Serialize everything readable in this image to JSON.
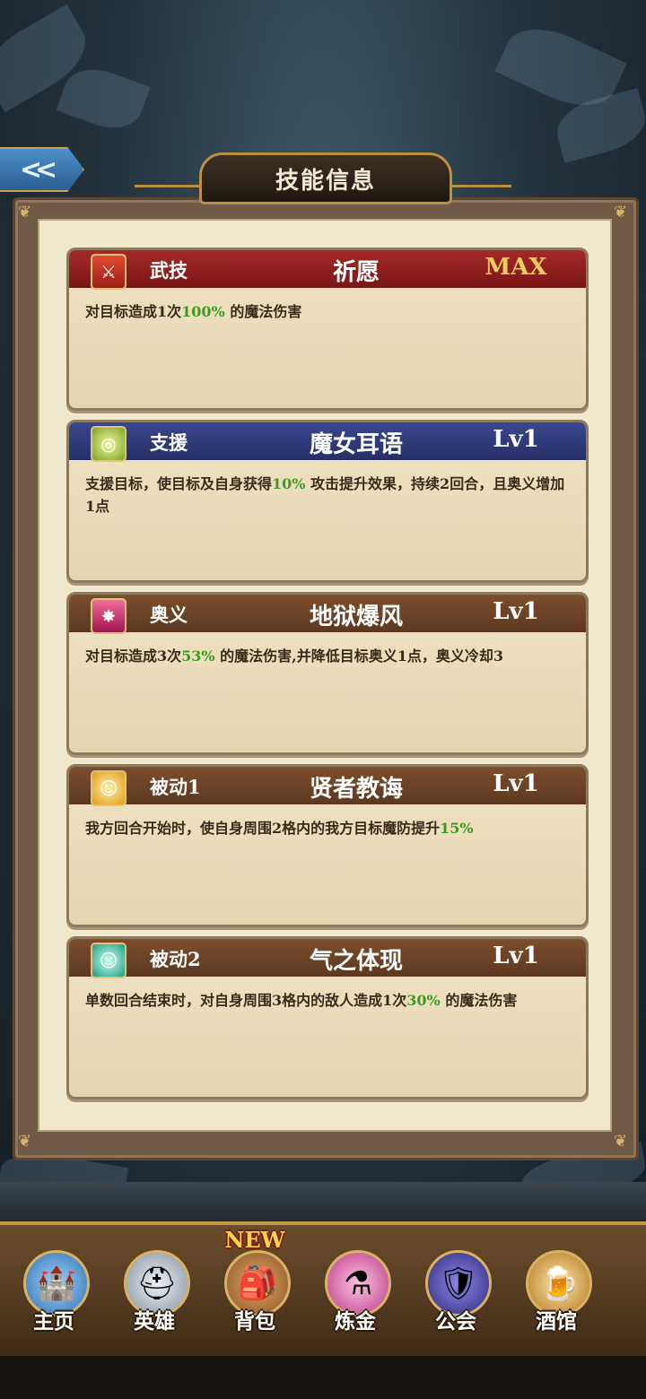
{
  "header": {
    "title": "技能信息",
    "back_icon": "double-chevron-left-icon"
  },
  "skills": [
    {
      "type": "武技",
      "name": "祈愿",
      "level": "MAX",
      "icon": "sword-icon",
      "head_color": "#8e1d1d",
      "desc_parts": [
        "对目标造成1次",
        "100%",
        " 的魔法伤害"
      ]
    },
    {
      "type": "支援",
      "name": "魔女耳语",
      "level": "Lv1",
      "icon": "magic-circle-icon",
      "head_color": "#2f3a75",
      "desc_parts": [
        "支援目标，使目标及自身获得",
        "10%",
        " 攻击提升效果，持续2回合，且奥义增加1点"
      ]
    },
    {
      "type": "奥义",
      "name": "地狱爆风",
      "level": "Lv1",
      "icon": "burst-icon",
      "head_color": "#6e4325",
      "desc_parts": [
        "对目标造成3次",
        "53%",
        " 的魔法伤害,并降低目标奥义1点，奥义冷却3"
      ]
    },
    {
      "type": "被动1",
      "name": "贤者教诲",
      "level": "Lv1",
      "icon": "person-aura-icon",
      "head_color": "#6e4325",
      "desc_parts": [
        "我方回合开始时，使自身周围2格内的我方目标魔防提升",
        "15%",
        ""
      ]
    },
    {
      "type": "被动2",
      "name": "气之体现",
      "level": "Lv1",
      "icon": "person-glow-icon",
      "head_color": "#6e4325",
      "desc_parts": [
        "单数回合结束时，对自身周围3格内的敌人造成1次",
        "30%",
        " 的魔法伤害"
      ]
    }
  ],
  "nav": {
    "items": [
      {
        "label": "主页",
        "icon": "castle-icon"
      },
      {
        "label": "英雄",
        "icon": "knight-helmet-icon"
      },
      {
        "label": "背包",
        "icon": "backpack-icon",
        "badge": "NEW"
      },
      {
        "label": "炼金",
        "icon": "potion-flask-icon"
      },
      {
        "label": "公会",
        "icon": "guild-shield-icon"
      },
      {
        "label": "酒馆",
        "icon": "tavern-mug-icon"
      }
    ]
  },
  "colors": {
    "highlight": "#3e9a22",
    "max_level": "#f0cc5c",
    "frame_gold": "#b9903f"
  }
}
